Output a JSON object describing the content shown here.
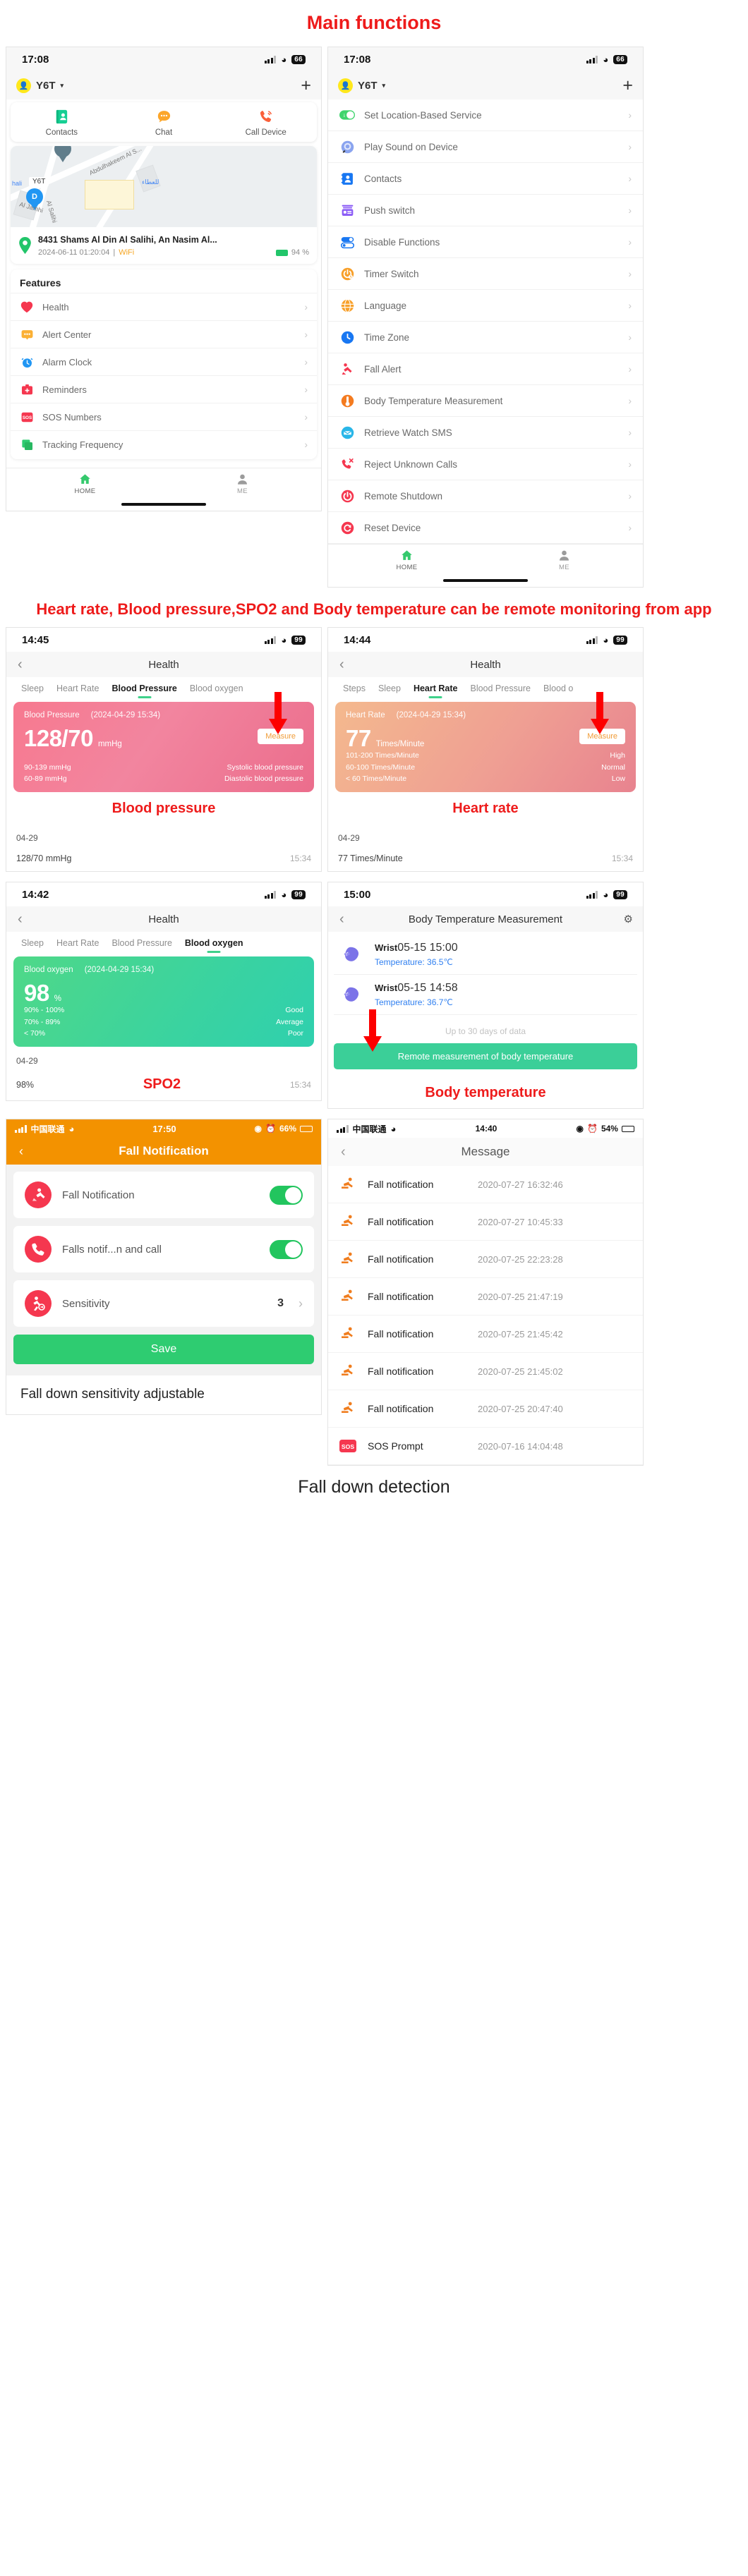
{
  "headings": {
    "main_functions": "Main functions",
    "remote_monitoring": "Heart rate, Blood pressure,SPO2 and Body temperature can be remote monitoring from app",
    "fall_detection": "Fall down detection"
  },
  "captions": {
    "blood_pressure": "Blood pressure",
    "heart_rate": "Heart rate",
    "spo2": "SPO2",
    "body_temperature": "Body temperature",
    "sensitivity_note": "Fall down sensitivity adjustable"
  },
  "home_screen": {
    "status": {
      "time": "17:08",
      "battery": "66"
    },
    "device": {
      "name": "Y6T",
      "caret": "▾",
      "add": "+"
    },
    "quick_actions": [
      {
        "label": "Contacts",
        "icon": "contacts-icon"
      },
      {
        "label": "Chat",
        "icon": "chat-icon"
      },
      {
        "label": "Call Device",
        "icon": "call-icon"
      }
    ],
    "map": {
      "device_label": "Y6T",
      "pin_letter": "D",
      "street_labels": [
        "Abdulhakeem Al S...",
        "Al Jamhi",
        "Al Salihi",
        "hali"
      ],
      "arabic_label": "للعطاء"
    },
    "location": {
      "address": "8431 Shams Al Din Al Salihi, An Nasim Al...",
      "timestamp": "2024-06-11 01:20:04",
      "separator": "|",
      "network": "WiFi",
      "battery": "94 %"
    },
    "features_title": "Features",
    "features": [
      {
        "label": "Health",
        "icon": "heart-icon"
      },
      {
        "label": "Alert Center",
        "icon": "alert-bubble-icon"
      },
      {
        "label": "Alarm Clock",
        "icon": "alarm-clock-icon"
      },
      {
        "label": "Reminders",
        "icon": "medkit-icon"
      },
      {
        "label": "SOS Numbers",
        "icon": "sos-icon"
      },
      {
        "label": "Tracking Frequency",
        "icon": "tracking-icon"
      }
    ],
    "tabbar": [
      {
        "label": "HOME",
        "icon": "home-icon",
        "active": true
      },
      {
        "label": "ME",
        "icon": "person-icon",
        "active": false
      }
    ]
  },
  "settings_screen": {
    "status": {
      "time": "17:08",
      "battery": "66"
    },
    "device": {
      "name": "Y6T",
      "caret": "▾",
      "add": "+"
    },
    "items": [
      {
        "label": "Set Location-Based Service",
        "icon": "location-toggle-icon"
      },
      {
        "label": "Play Sound on Device",
        "icon": "play-sound-icon"
      },
      {
        "label": "Contacts",
        "icon": "contacts-book-icon"
      },
      {
        "label": "Push switch",
        "icon": "push-switch-icon"
      },
      {
        "label": "Disable Functions",
        "icon": "disable-functions-icon"
      },
      {
        "label": "Timer Switch",
        "icon": "timer-switch-icon"
      },
      {
        "label": "Language",
        "icon": "language-globe-icon"
      },
      {
        "label": "Time Zone",
        "icon": "clock-icon"
      },
      {
        "label": "Fall Alert",
        "icon": "fall-alert-icon"
      },
      {
        "label": "Body Temperature Measurement",
        "icon": "thermometer-icon"
      },
      {
        "label": "Retrieve Watch SMS",
        "icon": "sms-icon"
      },
      {
        "label": "Reject Unknown Calls",
        "icon": "reject-call-icon"
      },
      {
        "label": "Remote Shutdown",
        "icon": "power-icon"
      },
      {
        "label": "Reset Device",
        "icon": "reset-icon"
      }
    ],
    "tabbar": [
      {
        "label": "HOME",
        "icon": "home-icon",
        "active": true
      },
      {
        "label": "ME",
        "icon": "person-icon",
        "active": false
      }
    ]
  },
  "blood_pressure_screen": {
    "status": {
      "time": "14:45",
      "battery": "99"
    },
    "title": "Health",
    "tabs": [
      "Sleep",
      "Heart Rate",
      "Blood Pressure",
      "Blood oxygen"
    ],
    "active_tab": "Blood Pressure",
    "card": {
      "label": "Blood Pressure",
      "timestamp": "(2024-04-29 15:34)",
      "value": "128/70",
      "unit": "mmHg",
      "measure_button": "Measure",
      "ranges": [
        {
          "range": "90-139 mmHg",
          "meaning": "Systolic blood pressure"
        },
        {
          "range": "60-89 mmHg",
          "meaning": "Diastolic blood pressure"
        }
      ]
    },
    "history_date": "04-29",
    "history": [
      {
        "value": "128/70 mmHg",
        "time": "15:34"
      }
    ]
  },
  "heart_rate_screen": {
    "status": {
      "time": "14:44",
      "battery": "99"
    },
    "title": "Health",
    "tabs": [
      "Steps",
      "Sleep",
      "Heart Rate",
      "Blood Pressure",
      "Blood o"
    ],
    "active_tab": "Heart Rate",
    "card": {
      "label": "Heart Rate",
      "timestamp": "(2024-04-29 15:34)",
      "value": "77",
      "unit": "Times/Minute",
      "measure_button": "Measure",
      "ranges": [
        {
          "range": "101-200 Times/Minute",
          "meaning": "High"
        },
        {
          "range": "60-100 Times/Minute",
          "meaning": "Normal"
        },
        {
          "range": "< 60 Times/Minute",
          "meaning": "Low"
        }
      ]
    },
    "history_date": "04-29",
    "history": [
      {
        "value": "77 Times/Minute",
        "time": "15:34"
      }
    ]
  },
  "spo2_screen": {
    "status": {
      "time": "14:42",
      "battery": "99"
    },
    "title": "Health",
    "tabs": [
      "Sleep",
      "Heart Rate",
      "Blood Pressure",
      "Blood oxygen"
    ],
    "active_tab": "Blood oxygen",
    "card": {
      "label": "Blood oxygen",
      "timestamp": "(2024-04-29 15:34)",
      "value": "98",
      "unit": "%",
      "ranges": [
        {
          "range": "90% - 100%",
          "meaning": "Good"
        },
        {
          "range": "70% - 89%",
          "meaning": "Average"
        },
        {
          "range": "< 70%",
          "meaning": "Poor"
        }
      ]
    },
    "history_date": "04-29",
    "history": [
      {
        "value": "98%",
        "time": "15:34"
      }
    ]
  },
  "body_temp_screen": {
    "status": {
      "time": "15:00",
      "battery": "99"
    },
    "title": "Body Temperature Measurement",
    "gear": "⚙",
    "records": [
      {
        "place": "Wrist",
        "time": "05-15 15:00",
        "temp_label": "Temperature:",
        "temp": "36.5℃"
      },
      {
        "place": "Wrist",
        "time": "05-15 14:58",
        "temp_label": "Temperature:",
        "temp": "36.7℃"
      }
    ],
    "note": "Up to 30 days of data",
    "button": "Remote measurement of body temperature"
  },
  "fall_notification_screen": {
    "status": {
      "carrier": "中国联通",
      "time": "17:50",
      "battery": "66%"
    },
    "title": "Fall Notification",
    "rows": [
      {
        "label": "Fall Notification",
        "icon": "fall-person-icon",
        "toggle": true
      },
      {
        "label": "Falls notif...n and call",
        "icon": "phone-icon",
        "toggle": true
      },
      {
        "label": "Sensitivity",
        "icon": "fall-sensitivity-icon",
        "value": "3",
        "chevron": "›"
      }
    ],
    "save": "Save"
  },
  "message_screen": {
    "status": {
      "carrier": "中国联通",
      "time": "14:40",
      "battery": "54%"
    },
    "title": "Message",
    "messages": [
      {
        "label": "Fall notification",
        "time": "2020-07-27 16:32:46",
        "icon": "fall-person-icon"
      },
      {
        "label": "Fall notification",
        "time": "2020-07-27 10:45:33",
        "icon": "fall-person-icon"
      },
      {
        "label": "Fall notification",
        "time": "2020-07-25 22:23:28",
        "icon": "fall-person-icon"
      },
      {
        "label": "Fall notification",
        "time": "2020-07-25 21:47:19",
        "icon": "fall-person-icon"
      },
      {
        "label": "Fall notification",
        "time": "2020-07-25 21:45:42",
        "icon": "fall-person-icon"
      },
      {
        "label": "Fall notification",
        "time": "2020-07-25 21:45:02",
        "icon": "fall-person-icon"
      },
      {
        "label": "Fall notification",
        "time": "2020-07-25 20:47:40",
        "icon": "fall-person-icon"
      },
      {
        "label": "SOS Prompt",
        "time": "2020-07-16 14:04:48",
        "icon": "sos-icon"
      }
    ]
  },
  "colors": {
    "accent_red": "#ee1b1b",
    "green": "#2ecc71",
    "orange": "#f39200",
    "blue": "#2196f3"
  }
}
